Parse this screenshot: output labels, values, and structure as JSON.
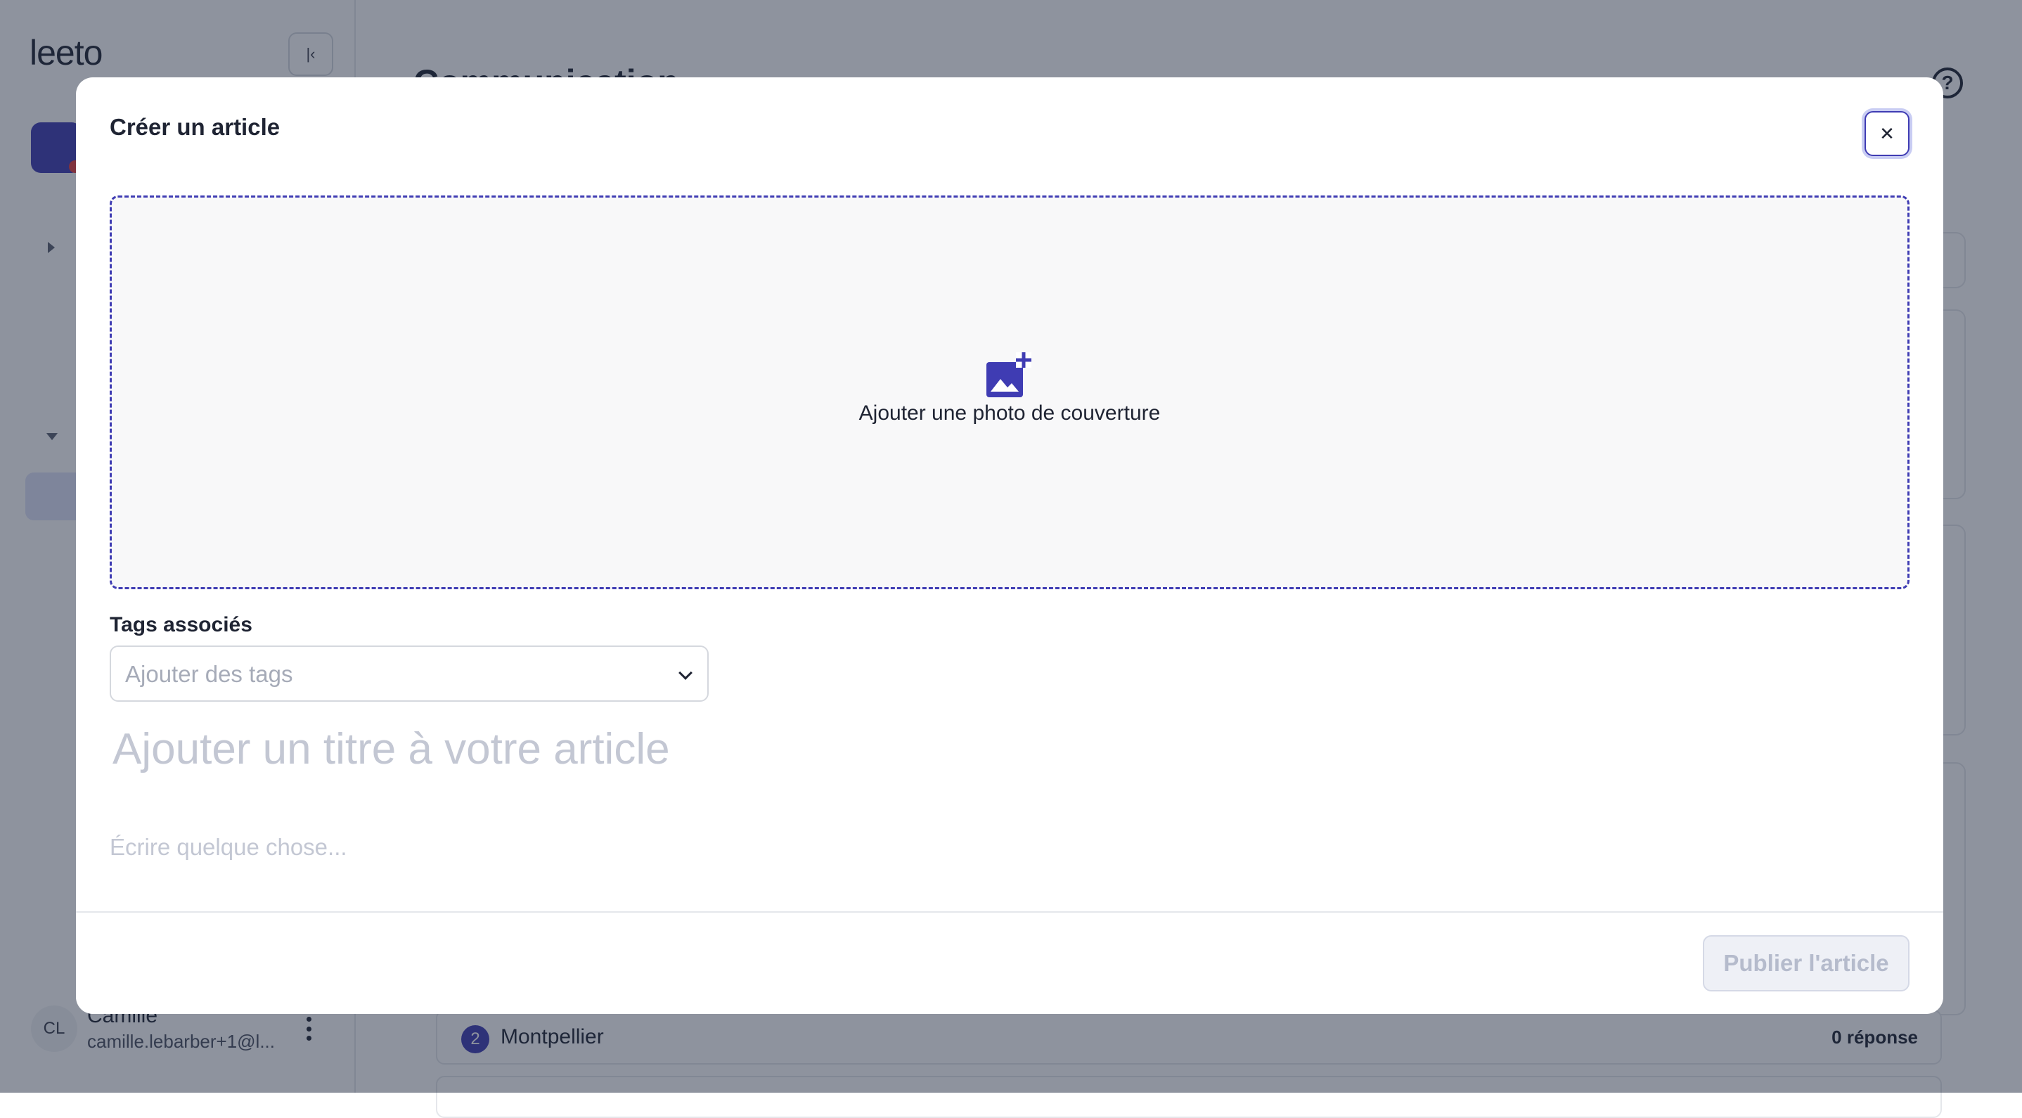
{
  "app": {
    "logo": "leeto",
    "page_title": "Communication",
    "user": {
      "initials": "CL",
      "name": "Camille",
      "email": "camille.lebarber+1@l..."
    },
    "poll": {
      "number": "2",
      "city": "Montpellier",
      "count": "0 réponse"
    }
  },
  "modal": {
    "title": "Créer un article",
    "cover": {
      "label": "Ajouter une photo de couverture",
      "icon": "add-photo-icon"
    },
    "tags": {
      "label": "Tags associés",
      "placeholder": "Ajouter des tags"
    },
    "article_title_placeholder": "Ajouter un titre à votre article",
    "body_placeholder": "Écrire quelque chose...",
    "publish_label": "Publier l'article"
  },
  "colors": {
    "accent": "#3f3cb3",
    "overlay": "#1d273d",
    "placeholder": "#c3c7d3"
  }
}
